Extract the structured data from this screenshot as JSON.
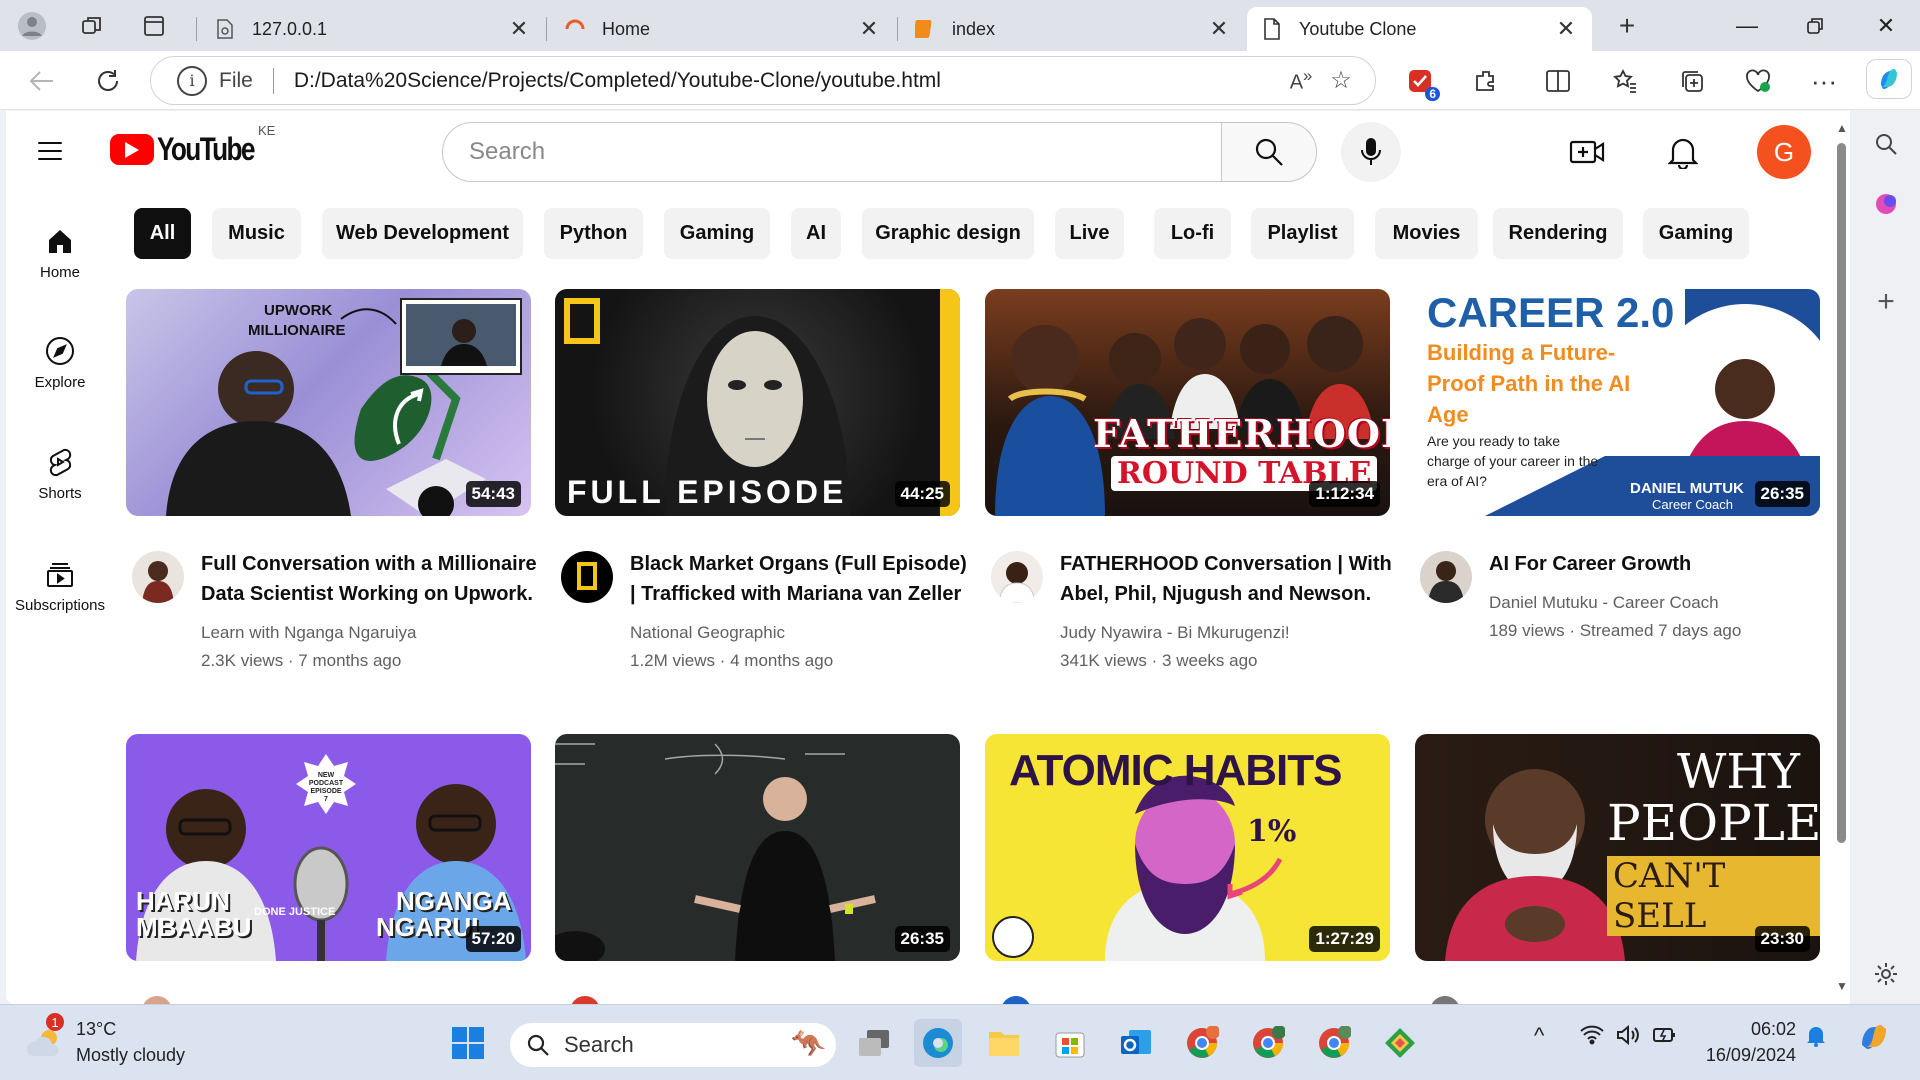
{
  "browser": {
    "tabs": [
      {
        "title": "127.0.0.1",
        "favicon": "page-icon"
      },
      {
        "title": "Home",
        "favicon": "loading-icon"
      },
      {
        "title": "index",
        "favicon": "html-icon"
      },
      {
        "title": "Youtube Clone",
        "favicon": "document-icon",
        "active": true
      }
    ],
    "address": {
      "scheme": "File",
      "url": "D:/Data%20Science/Projects/Completed/Youtube-Clone/youtube.html"
    },
    "extension_badge": "6"
  },
  "youtube": {
    "logo_text": "YouTube",
    "country_code": "KE",
    "search_placeholder": "Search",
    "avatar_letter": "G",
    "sidebar": [
      {
        "label": "Home",
        "icon": "home-icon"
      },
      {
        "label": "Explore",
        "icon": "compass-icon"
      },
      {
        "label": "Shorts",
        "icon": "shorts-icon"
      },
      {
        "label": "Subscriptions",
        "icon": "subscriptions-icon"
      }
    ],
    "chips": [
      "All",
      "Music",
      "Web Development",
      "Python",
      "Gaming",
      "AI",
      "Graphic design",
      "Live",
      "Lo-fi",
      "Playlist",
      "Movies",
      "Rendering",
      "Gaming"
    ],
    "videos": [
      {
        "thumb_text": [
          "UPWORK",
          "MILLIONAIRE"
        ],
        "duration": "54:43",
        "title": "Full Conversation with a Millionaire Data Scientist Working on Upwork.",
        "channel": "Learn with Nganga Ngaruiya",
        "stats": "2.3K views · 7 months ago"
      },
      {
        "thumb_text": [
          "FULL EPISODE"
        ],
        "duration": "44:25",
        "title": "Black Market Organs (Full Episode) | Trafficked with Mariana van Zeller",
        "channel": "National Geographic",
        "stats": "1.2M views · 4 months ago"
      },
      {
        "thumb_text": [
          "FATHERHOOD",
          "ROUND TABLE"
        ],
        "duration": "1:12:34",
        "title": "FATHERHOOD Conversation | With Abel, Phil, Njugush and Newson.",
        "channel": "Judy Nyawira - Bi Mkurugenzi!",
        "stats": "341K views · 3 weeks ago"
      },
      {
        "thumb_text": [
          "CAREER 2.0",
          "Building a Future-Proof Path in the AI Age",
          "Are you ready to take charge of your career in the era of AI?",
          "DANIEL MUTUK",
          "Career Coach"
        ],
        "duration": "26:35",
        "title": "AI For Career Growth",
        "channel": "Daniel Mutuku - Career Coach",
        "stats": "189 views · Streamed 7 days ago"
      },
      {
        "thumb_text": [
          "HARUN",
          "MBAABU",
          "NGANGA",
          "NGARUI",
          "NEW PODCAST EPISODE 7",
          "DONE JUSTICE"
        ],
        "duration": "57:20"
      },
      {
        "thumb_text": [],
        "duration": "26:35"
      },
      {
        "thumb_text": [
          "ATOMIC HABITS",
          "1%"
        ],
        "duration": "1:27:29"
      },
      {
        "thumb_text": [
          "WHY",
          "PEOPLE",
          "CAN'T SELL"
        ],
        "duration": "23:30"
      }
    ]
  },
  "taskbar": {
    "weather_temp": "13°C",
    "weather_desc": "Mostly cloudy",
    "weather_badge": "1",
    "search_placeholder": "Search",
    "time": "06:02",
    "date": "16/09/2024"
  }
}
